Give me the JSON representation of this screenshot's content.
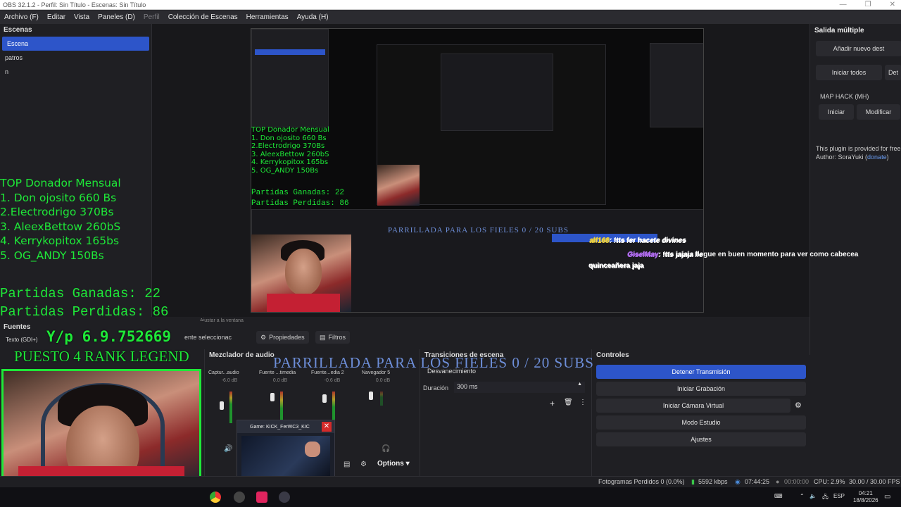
{
  "window": {
    "title": "OBS 32.1.2 - Perfil: Sin Título - Escenas: Sin Título",
    "controls": [
      "—",
      "❐",
      "✕"
    ]
  },
  "menu": {
    "items": [
      "Archivo (F)",
      "Editar",
      "Vista",
      "Paneles (D)",
      "Perfil",
      "Colección de Escenas",
      "Herramientas",
      "Ayuda (H)"
    ]
  },
  "scenes": {
    "title": "Escenas",
    "items": [
      "Escena",
      "patros",
      "n"
    ]
  },
  "overlay": {
    "donor_title": "TOP Donador Mensual",
    "donors": [
      "1. Don ojosito 660 Bs",
      "2.Electrodrigo 370Bs",
      "3. AleexBettow 260bS",
      "4. Kerrykopitox 165bs",
      "5. OG_ANDY  150Bs"
    ],
    "wins": "Partidas Ganadas: 22",
    "losses": "Partidas Perdidas: 86",
    "sub_text": "Y/p 6.9.752669",
    "rank": "PUESTO 4 RANK LEGEND",
    "parrillada": "PARRILLADA PARA LOS FIELES 0 / 20 SUBS",
    "chat": [
      {
        "user": "alf168",
        "msg": ": !tts fer hacete divines"
      },
      {
        "user": "GiselMay",
        "msg": ": !tts jajaja llegue en buen momento para ver como cabecea"
      }
    ],
    "chat_tail": "quinceañera jaja"
  },
  "right_dock": {
    "title": "Salida múltiple",
    "add_btn": "Añadir nuevo dest",
    "start_all": "Iniciar todos",
    "stop_all": "Det",
    "section": "MAP HACK (MH)",
    "start": "Iniciar",
    "modify": "Modificar",
    "plugin_note": "This plugin is provided for free",
    "author_prefix": "Author: SoraYuki (",
    "author_link": "donate",
    "author_suffix": ")"
  },
  "toolbar": {
    "selected_source": "ente seleccionac",
    "properties": "Propiedades",
    "filters": "Filtros"
  },
  "sources": {
    "title": "Fuentes",
    "items": [
      "Texto (GDI+)"
    ]
  },
  "mixer": {
    "title": "Mezclador de audio",
    "channels": [
      {
        "name": "Captur...audio",
        "db": "-6.0 dB",
        "level": 0.45
      },
      {
        "name": "Fuente ...timedia",
        "db": "0.0 dB",
        "level": 0.6
      },
      {
        "name": "Fuente...edia 2",
        "db": "-0.6 dB",
        "level": 0.55
      },
      {
        "name": "Navegador 5",
        "db": "0.0 dB",
        "level": 0.2
      }
    ],
    "options": "Options"
  },
  "transitions": {
    "title": "Transiciones de escena",
    "selected": "Desvanecimiento",
    "duration_label": "Duración",
    "duration_value": "300 ms"
  },
  "controls": {
    "title": "Controles",
    "stop_stream": "Detener Transmisión",
    "start_recording": "Iniciar Grabación",
    "virtual_cam": "Iniciar Cámara Virtual",
    "studio_mode": "Modo Estudio",
    "settings": "Ajustes"
  },
  "camera_popup": {
    "title": "Game: KICK_FerWC3_KIC"
  },
  "status": {
    "dropped": "Fotogramas Perdidos 0 (0.0%)",
    "bitrate": "5592 kbps",
    "stream_time": "07:44:25",
    "rec_time": "00:00:00",
    "cpu": "CPU: 2.9%",
    "fps": "30.00 / 30.00 FPS"
  },
  "taskbar": {
    "lang": "ESP",
    "time": "04:21",
    "date": "18/8/2026"
  },
  "preview_nested": {
    "align_text": "Ajustar a la ventana"
  }
}
